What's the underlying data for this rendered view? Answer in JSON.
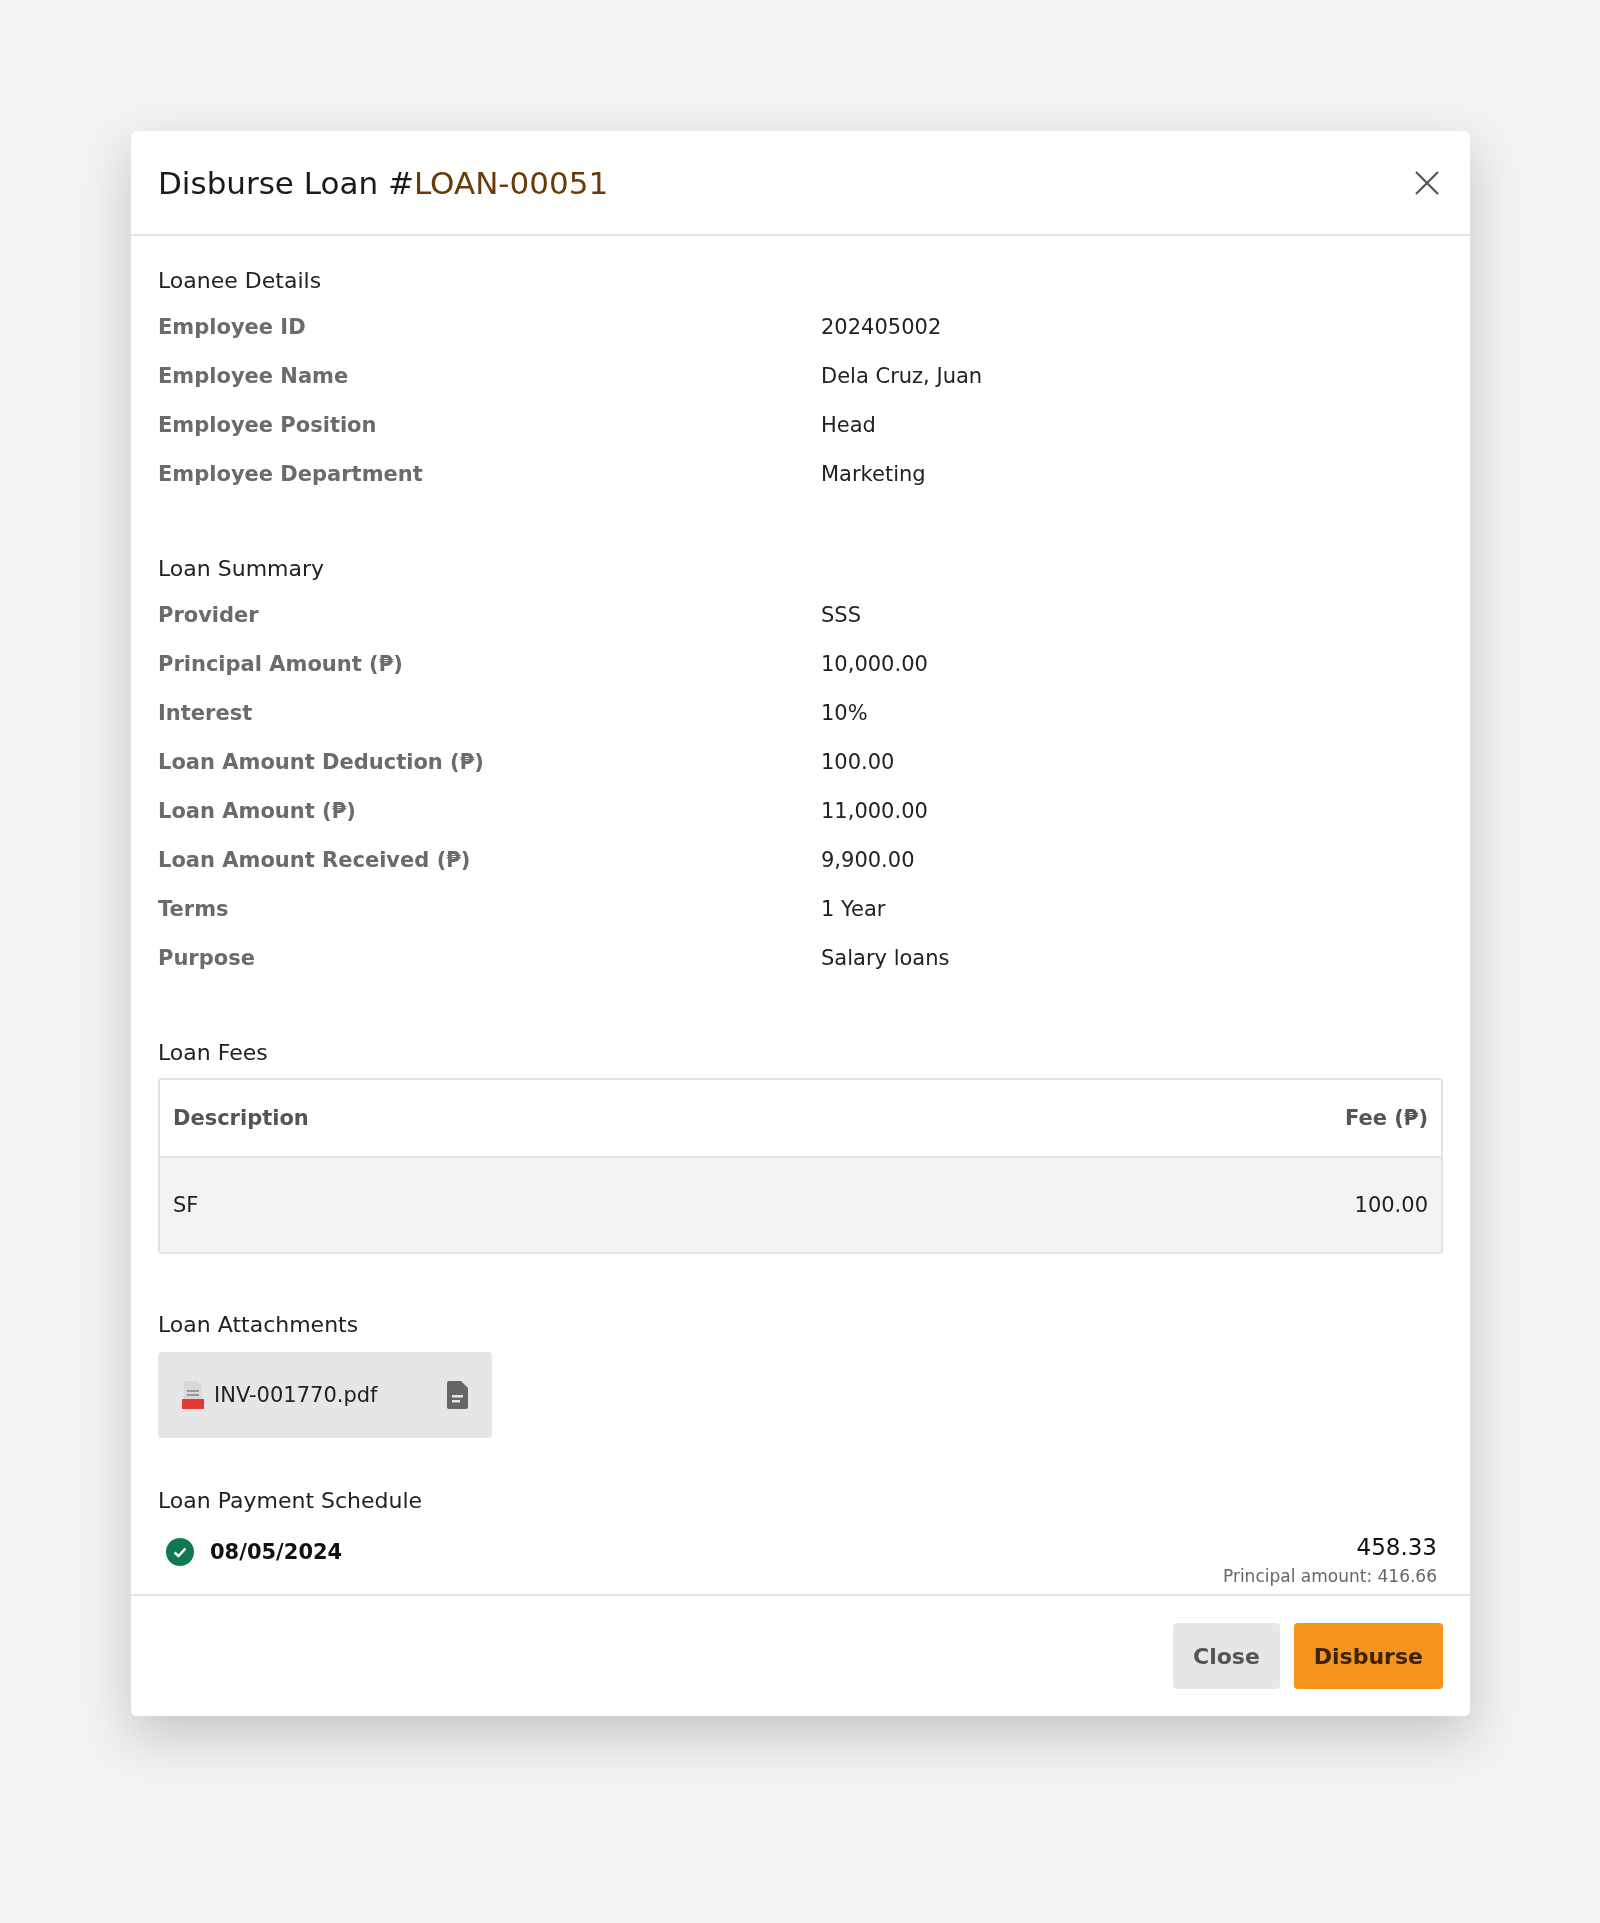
{
  "modal": {
    "title_prefix": "Disburse Loan #",
    "loan_number": "LOAN-00051"
  },
  "loanee_details": {
    "heading": "Loanee Details",
    "rows": [
      {
        "label": "Employee ID",
        "value": "202405002"
      },
      {
        "label": "Employee Name",
        "value": "Dela Cruz, Juan"
      },
      {
        "label": "Employee Position",
        "value": "Head"
      },
      {
        "label": "Employee Department",
        "value": "Marketing"
      }
    ]
  },
  "loan_summary": {
    "heading": "Loan Summary",
    "rows": [
      {
        "label": "Provider",
        "value": "SSS"
      },
      {
        "label": "Principal Amount (₱)",
        "value": "10,000.00"
      },
      {
        "label": "Interest",
        "value": "10%"
      },
      {
        "label": "Loan Amount Deduction (₱)",
        "value": "100.00"
      },
      {
        "label": "Loan Amount (₱)",
        "value": "11,000.00"
      },
      {
        "label": "Loan Amount Received (₱)",
        "value": "9,900.00"
      },
      {
        "label": "Terms",
        "value": "1 Year"
      },
      {
        "label": "Purpose",
        "value": "Salary loans"
      }
    ]
  },
  "loan_fees": {
    "heading": "Loan Fees",
    "columns": [
      "Description",
      "Fee (₱)"
    ],
    "rows": [
      [
        "SF",
        "100.00"
      ]
    ]
  },
  "loan_attachments": {
    "heading": "Loan Attachments",
    "files": [
      {
        "name": "INV-001770.pdf"
      }
    ]
  },
  "payment_schedule": {
    "heading": "Loan Payment Schedule",
    "items": [
      {
        "date": "08/05/2024",
        "paid": true,
        "amount": "458.33",
        "principal": "Principal amount: 416.66"
      }
    ]
  },
  "buttons": [
    {
      "label": "Close",
      "kind": "secondary"
    },
    {
      "label": "Disburse",
      "kind": "primary"
    }
  ]
}
